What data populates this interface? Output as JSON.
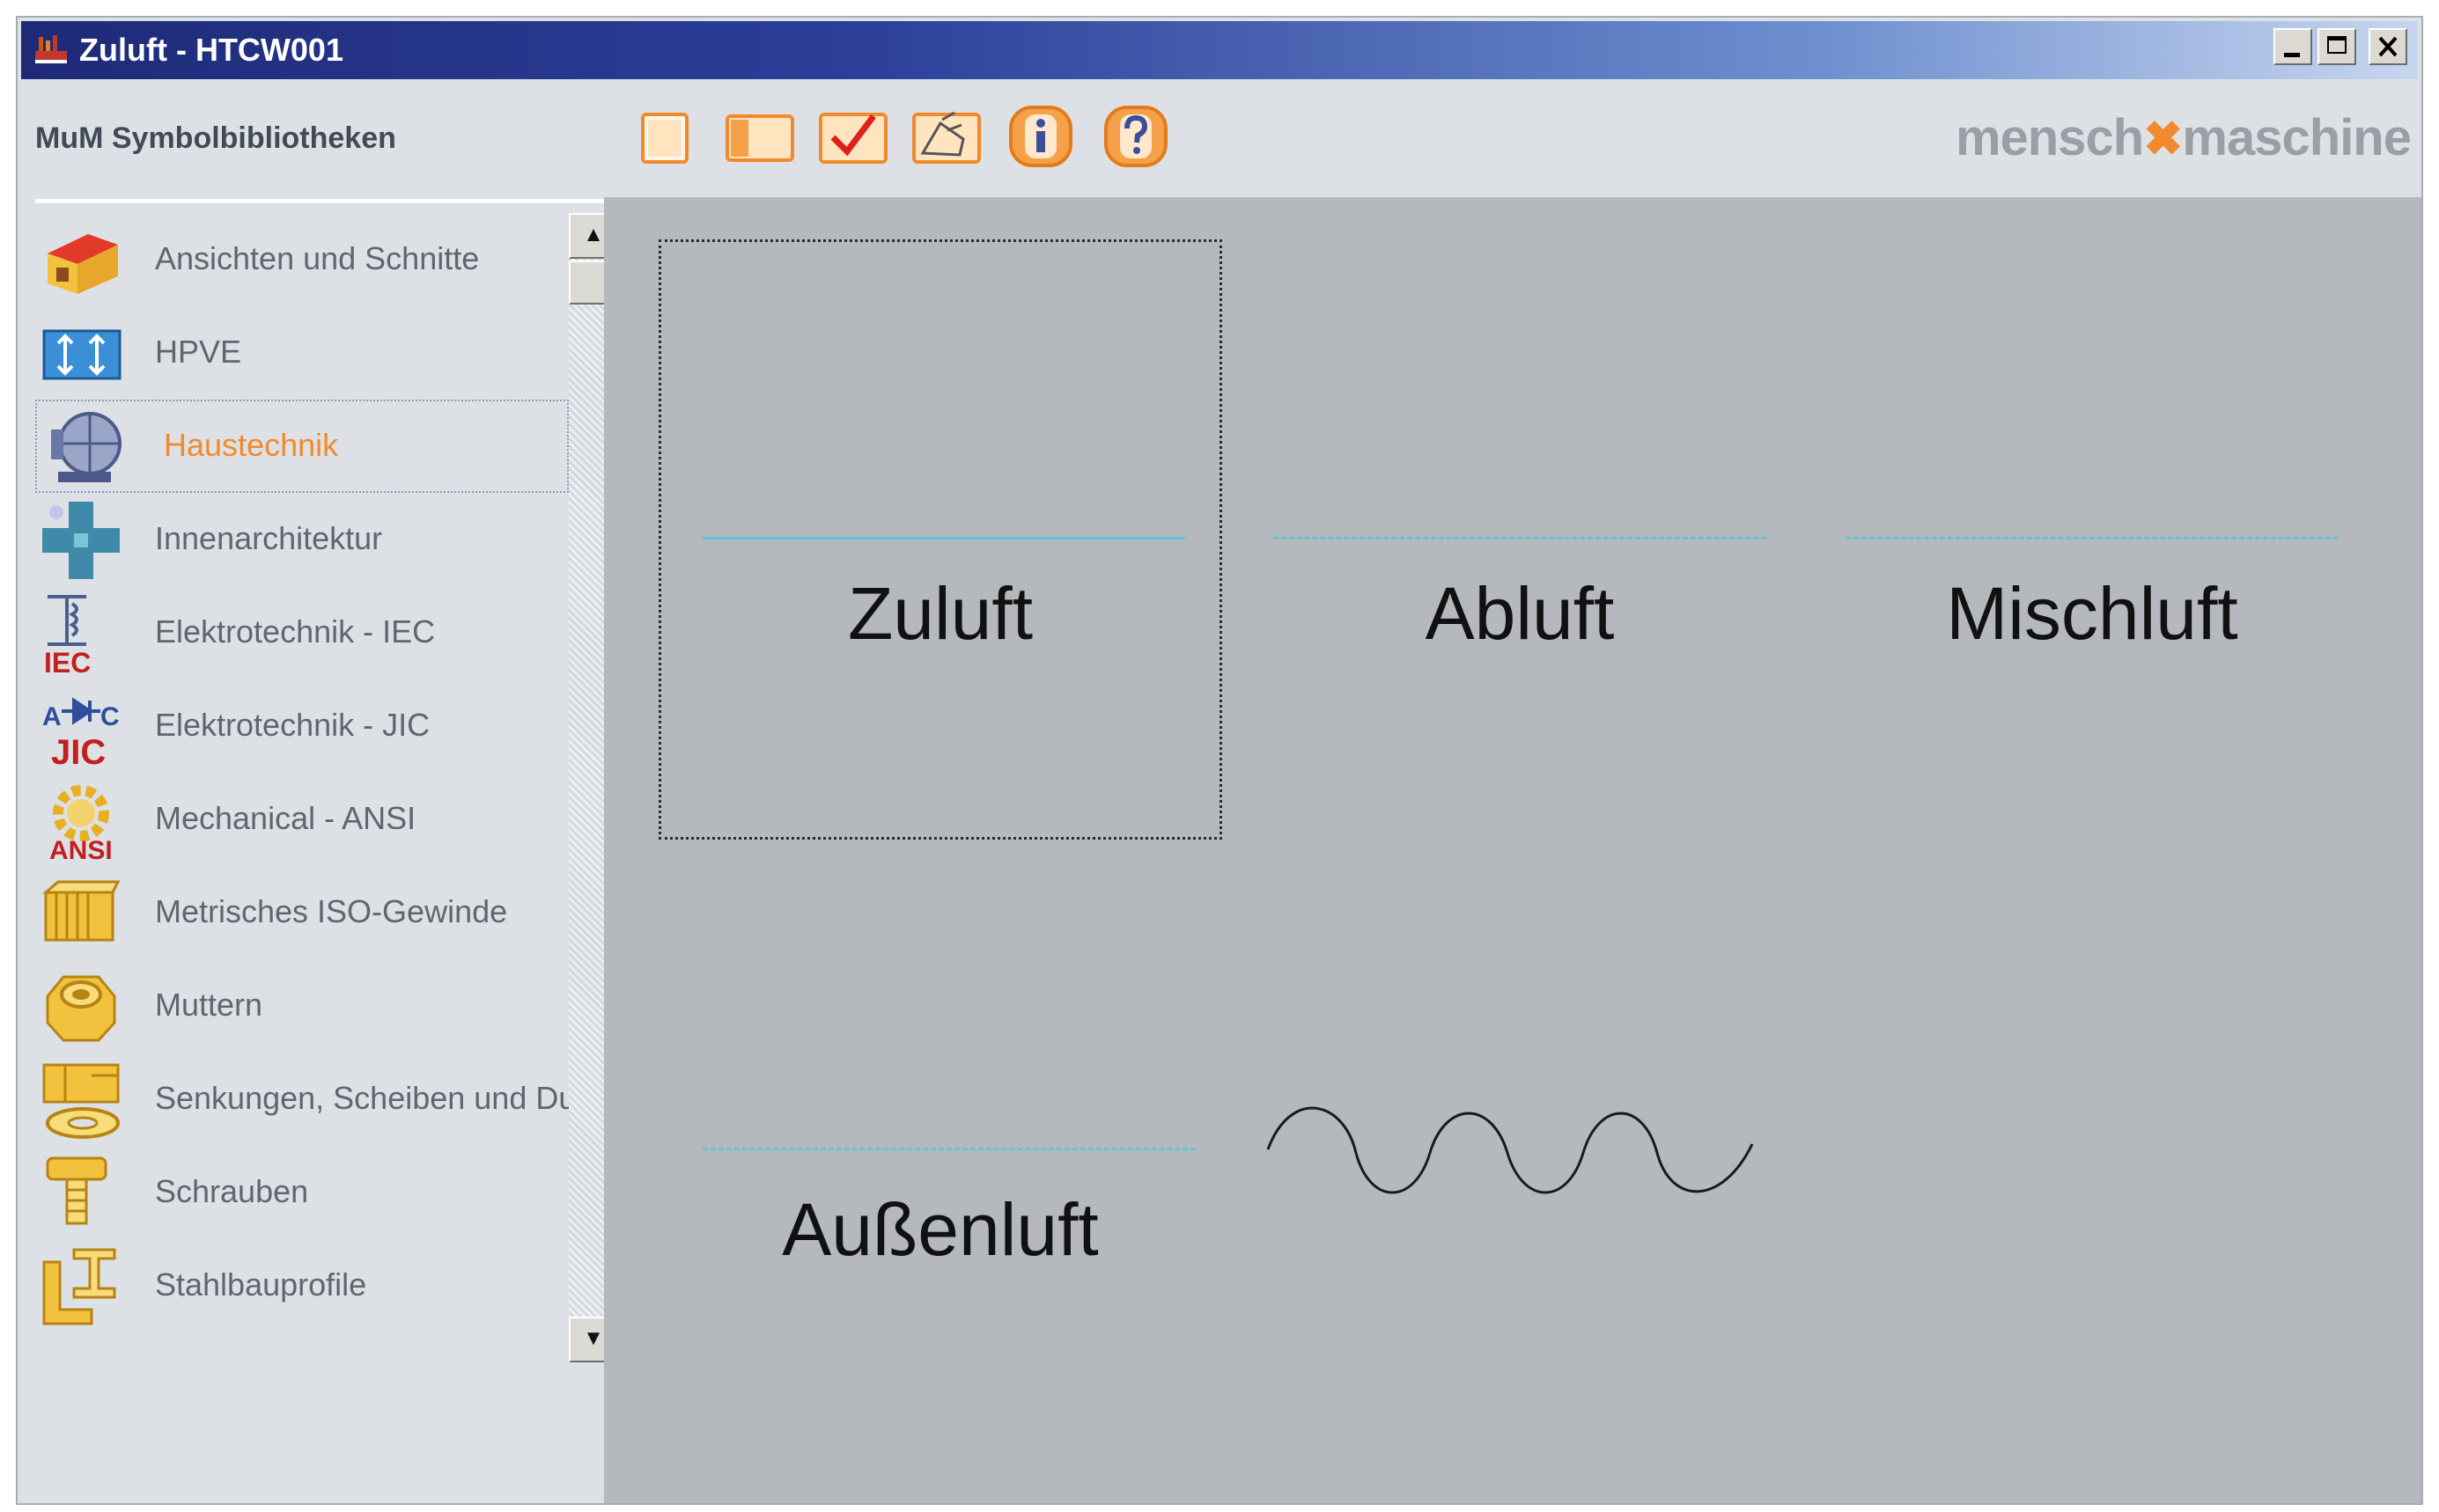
{
  "window": {
    "title": "Zuluft - HTCW001",
    "controls": [
      "minimize",
      "maximize",
      "close"
    ]
  },
  "toolbar": {
    "app_label": "MuM Symbolbibliotheken",
    "buttons": [
      {
        "name": "new-document",
        "icon": "blank-page-icon"
      },
      {
        "name": "open-book",
        "icon": "book-icon"
      },
      {
        "name": "check",
        "icon": "checkmark-icon"
      },
      {
        "name": "dimension",
        "icon": "dimension-icon"
      },
      {
        "name": "info",
        "icon": "info-icon"
      },
      {
        "name": "help",
        "icon": "help-icon"
      }
    ],
    "brand_left": "mensch",
    "brand_mark": "✖",
    "brand_right": "maschine"
  },
  "sidebar": {
    "selected_index": 2,
    "items": [
      {
        "label": "Ansichten und Schnitte",
        "icon": "house-icon"
      },
      {
        "label": "HPVE",
        "icon": "hpve-arrows-icon"
      },
      {
        "label": "Haustechnik",
        "icon": "fan-icon"
      },
      {
        "label": "Innenarchitektur",
        "icon": "cross-piece-icon"
      },
      {
        "label": "Elektrotechnik - IEC",
        "icon": "iec-transformer-icon",
        "badge": "IEC"
      },
      {
        "label": "Elektrotechnik - JIC",
        "icon": "jic-diode-icon",
        "badge": "JIC"
      },
      {
        "label": "Mechanical - ANSI",
        "icon": "ansi-gear-icon",
        "badge": "ANSI"
      },
      {
        "label": "Metrisches ISO-Gewinde",
        "icon": "thread-icon"
      },
      {
        "label": "Muttern",
        "icon": "nut-icon"
      },
      {
        "label": "Senkungen, Scheiben und Du",
        "icon": "washer-icon"
      },
      {
        "label": "Schrauben",
        "icon": "screw-icon"
      },
      {
        "label": "Stahlbauprofile",
        "icon": "steel-profile-icon"
      }
    ]
  },
  "symbols": [
    {
      "label": "Zuluft",
      "line": "solid",
      "selected": true
    },
    {
      "label": "Abluft",
      "line": "dashed",
      "selected": false
    },
    {
      "label": "Mischluft",
      "line": "dashed",
      "selected": false
    },
    {
      "label": "Außenluft",
      "line": "dashed",
      "selected": false
    },
    {
      "label": "",
      "line": "wave",
      "selected": false
    }
  ],
  "colors": {
    "title_gradient_start": "#1e2a78",
    "title_gradient_end": "#c7d6ef",
    "accent": "#f08a2c",
    "canvas_bg": "#b5b8bc",
    "panel_bg": "#dde1e6",
    "symbol_line": "#62c4d8"
  }
}
